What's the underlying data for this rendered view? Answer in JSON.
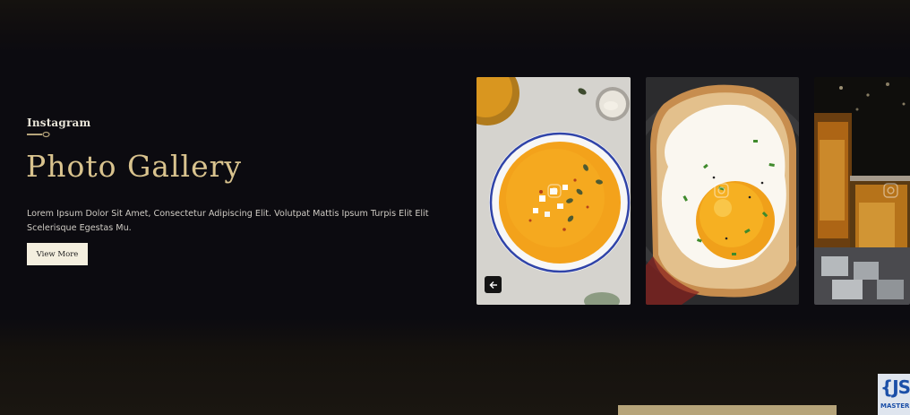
{
  "section": {
    "tagline": "Instagram",
    "title": "Photo Gallery",
    "description": "Lorem Ipsum Dolor Sit Amet, Consectetur Adipiscing Elit. Volutpat Mattis Ipsum Turpis Elit Elit Scelerisque Egestas Mu.",
    "button_label": "View More"
  },
  "gallery": {
    "items": [
      {
        "subject": "pumpkin soup bowl",
        "overlay_icon": "instagram-icon"
      },
      {
        "subject": "fried egg on toast",
        "overlay_icon": "instagram-icon"
      },
      {
        "subject": "whiskey glasses",
        "overlay_icon": "instagram-icon"
      }
    ],
    "prev_icon": "arrow-left-icon"
  },
  "watermark": {
    "logo_text": "{JS",
    "logo_subtext": "MASTER"
  },
  "colors": {
    "background": "#0c0b10",
    "title_gold": "#d9c38e",
    "button_bg": "#f4efdf",
    "accent_bar": "#b6a47a"
  }
}
